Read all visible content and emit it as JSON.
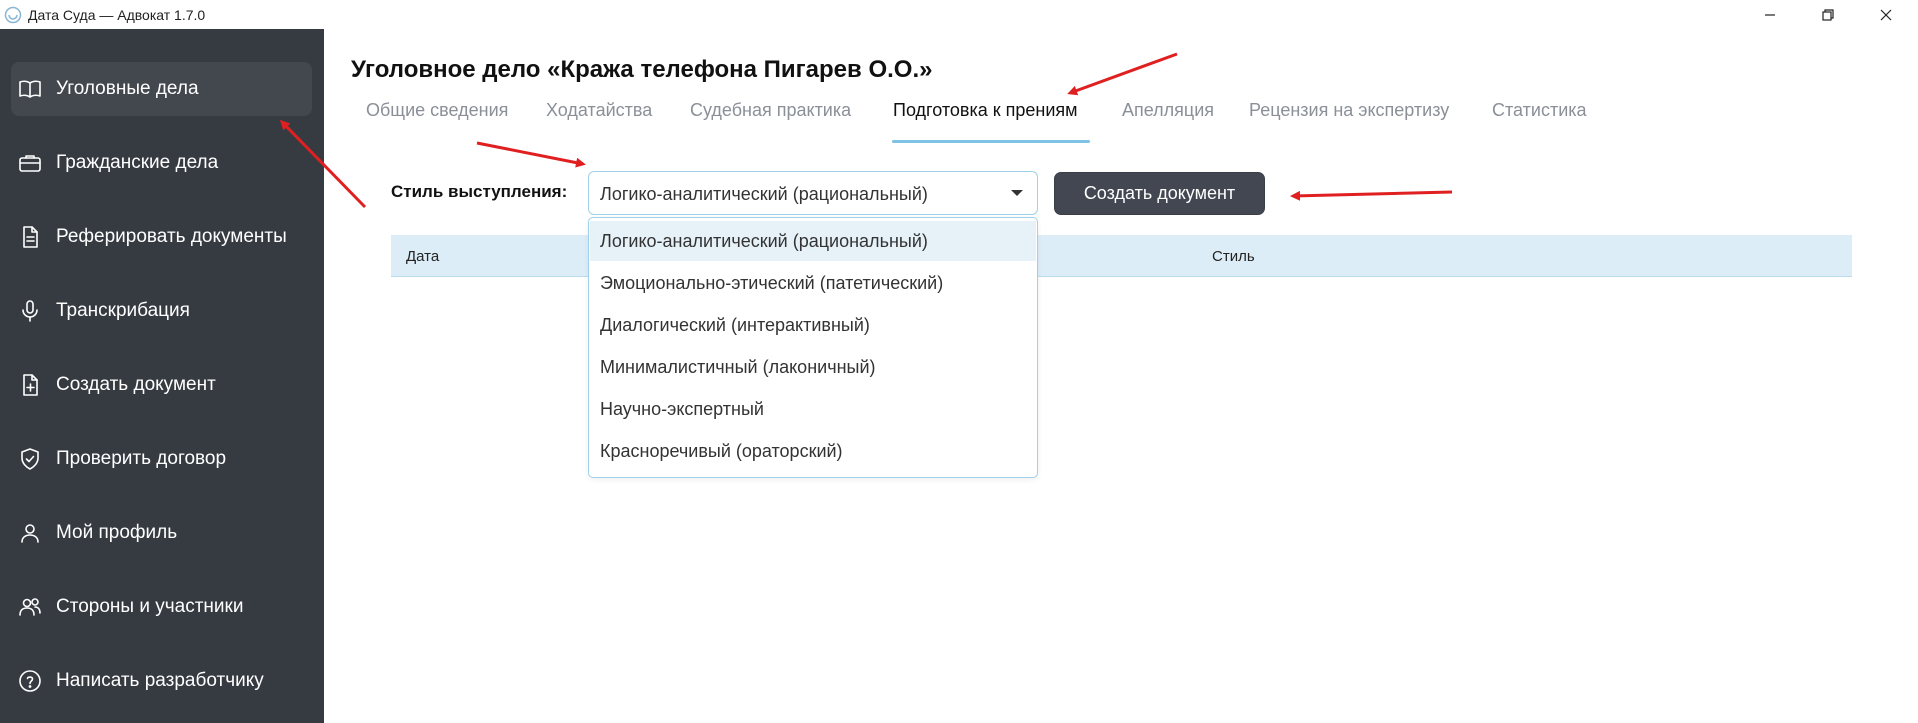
{
  "window": {
    "title": "Дата Суда — Адвокат 1.7.0",
    "logo_icon": "scales-logo-icon"
  },
  "sidebar": {
    "items": [
      {
        "label": "Уголовные дела",
        "icon": "book-open-icon",
        "active": true
      },
      {
        "label": "Гражданские дела",
        "icon": "briefcase-icon"
      },
      {
        "label": "Реферировать документы",
        "icon": "document-text-icon"
      },
      {
        "label": "Транскрибация",
        "icon": "microphone-icon"
      },
      {
        "label": "Создать документ",
        "icon": "document-plus-icon"
      },
      {
        "label": "Проверить договор",
        "icon": "shield-check-icon"
      },
      {
        "label": "Мой профиль",
        "icon": "user-icon"
      },
      {
        "label": "Стороны и участники",
        "icon": "users-icon"
      },
      {
        "label": "Написать разработчику",
        "icon": "question-circle-icon"
      }
    ]
  },
  "main": {
    "title": "Уголовное дело «Кража телефона Пигарев О.О.»",
    "tabs": [
      {
        "label": "Общие сведения"
      },
      {
        "label": "Ходатайства"
      },
      {
        "label": "Судебная практика"
      },
      {
        "label": "Подготовка к прениям",
        "active": true
      },
      {
        "label": "Апелляция"
      },
      {
        "label": "Рецензия на экспертизу"
      },
      {
        "label": "Статистика"
      }
    ],
    "style_label": "Стиль выступления:",
    "style_select": {
      "value": "Логико-аналитический (рациональный)",
      "options": [
        "Логико-аналитический (рациональный)",
        "Эмоционально-этический (патетический)",
        "Диалогический (интерактивный)",
        "Минималистичный (лаконичный)",
        "Научно-экспертный",
        "Красноречивый (ораторский)"
      ]
    },
    "create_button": "Создать документ",
    "table": {
      "columns": [
        "Дата",
        "Стиль"
      ]
    }
  },
  "colors": {
    "sidebar_bg": "#363a41",
    "sidebar_active": "#43474e",
    "accent": "#7ec3e6",
    "table_header_bg": "#dcedf8",
    "button_bg": "#424752",
    "annotation_arrow": "#e02020"
  }
}
